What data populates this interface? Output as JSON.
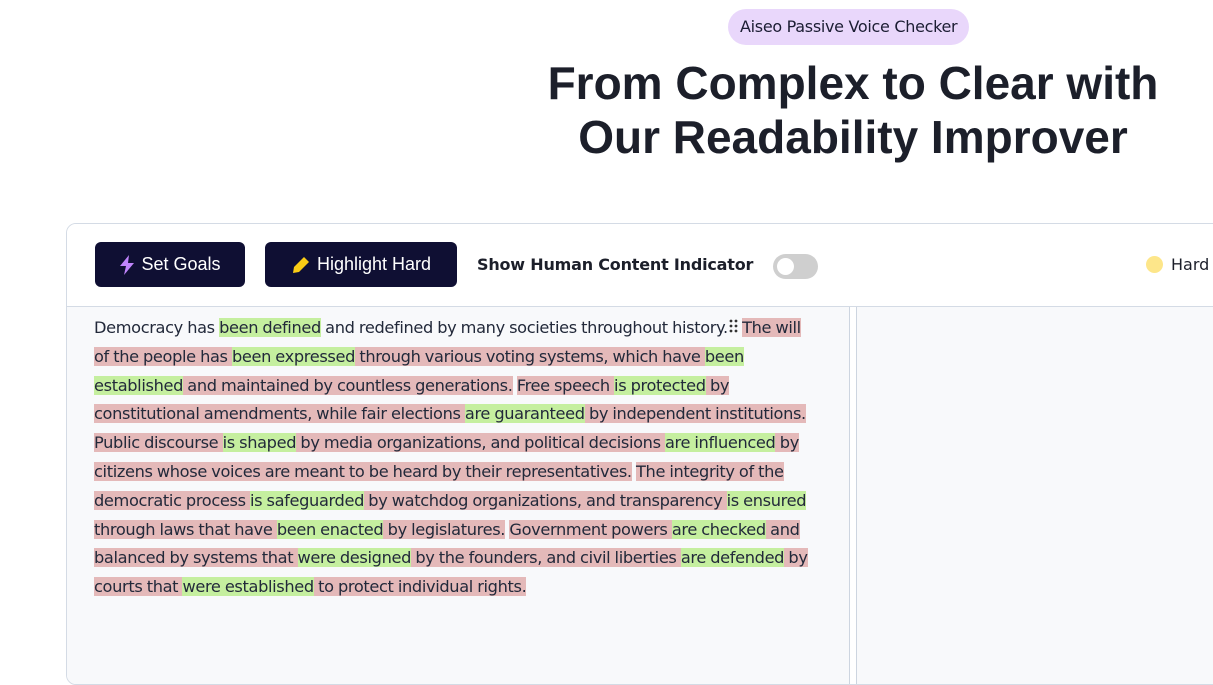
{
  "hero": {
    "badge": "Aiseo Passive Voice Checker",
    "title_line1": "From Complex to Clear with",
    "title_line2": "Our Readability Improver"
  },
  "toolbar": {
    "set_goals_label": "Set Goals",
    "set_goals_icon": "lightning-bolt-icon",
    "highlight_hard_label": "Highlight Hard",
    "highlight_hard_icon": "highlighter-icon",
    "toggle_label": "Show Human Content Indicator",
    "toggle_on": false,
    "legend_label": "Hard",
    "legend_color": "#fde68a"
  },
  "colors": {
    "button_bg": "#0f0f33",
    "badge_bg": "#e9d7fb",
    "hard_highlight": "#e4b9b9",
    "passive_highlight": "#c5ef9f",
    "bolt": "#c084fc",
    "highlighter": "#facc15"
  },
  "editor": {
    "segments": [
      {
        "t": "Democracy has ",
        "k": "plain"
      },
      {
        "t": "been defined",
        "k": "pv"
      },
      {
        "t": " and redefined by many societies throughout history.",
        "k": "plain"
      },
      {
        "t": " ",
        "k": "plain"
      },
      {
        "t": "The will of the people has ",
        "k": "hard"
      },
      {
        "t": "been expressed",
        "k": "pv"
      },
      {
        "t": " through various voting systems, which have ",
        "k": "hard"
      },
      {
        "t": "been established",
        "k": "pv"
      },
      {
        "t": " and maintained by countless generations.",
        "k": "hard"
      },
      {
        "t": " ",
        "k": "plain"
      },
      {
        "t": "Free speech ",
        "k": "hard"
      },
      {
        "t": "is protected",
        "k": "pv"
      },
      {
        "t": " by constitutional amendments, while fair elections ",
        "k": "hard"
      },
      {
        "t": "are guaranteed",
        "k": "pv"
      },
      {
        "t": " by independent institutions.",
        "k": "hard"
      },
      {
        "t": " ",
        "k": "plain"
      },
      {
        "t": "Public discourse ",
        "k": "hard"
      },
      {
        "t": "is shaped",
        "k": "pv"
      },
      {
        "t": " by media organizations, and political decisions ",
        "k": "hard"
      },
      {
        "t": "are influenced",
        "k": "pv"
      },
      {
        "t": " by citizens whose voices are meant to be heard by their representatives.",
        "k": "hard"
      },
      {
        "t": " ",
        "k": "plain"
      },
      {
        "t": "The integrity of the democratic process ",
        "k": "hard"
      },
      {
        "t": "is safeguarded",
        "k": "pv"
      },
      {
        "t": " by watchdog organizations, and transparency ",
        "k": "hard"
      },
      {
        "t": "is ensured",
        "k": "pv"
      },
      {
        "t": " through laws that have ",
        "k": "hard"
      },
      {
        "t": "been enacted",
        "k": "pv"
      },
      {
        "t": " by legislatures.",
        "k": "hard"
      },
      {
        "t": " ",
        "k": "plain"
      },
      {
        "t": "Government powers ",
        "k": "hard"
      },
      {
        "t": "are checked",
        "k": "pv"
      },
      {
        "t": " and balanced by systems that ",
        "k": "hard"
      },
      {
        "t": "were designed",
        "k": "pv"
      },
      {
        "t": " by the founders, and civil liberties ",
        "k": "hard"
      },
      {
        "t": "are defended",
        "k": "pv"
      },
      {
        "t": " by courts that ",
        "k": "hard"
      },
      {
        "t": "were established",
        "k": "pv"
      },
      {
        "t": " to protect individual rights.",
        "k": "hard"
      }
    ]
  }
}
